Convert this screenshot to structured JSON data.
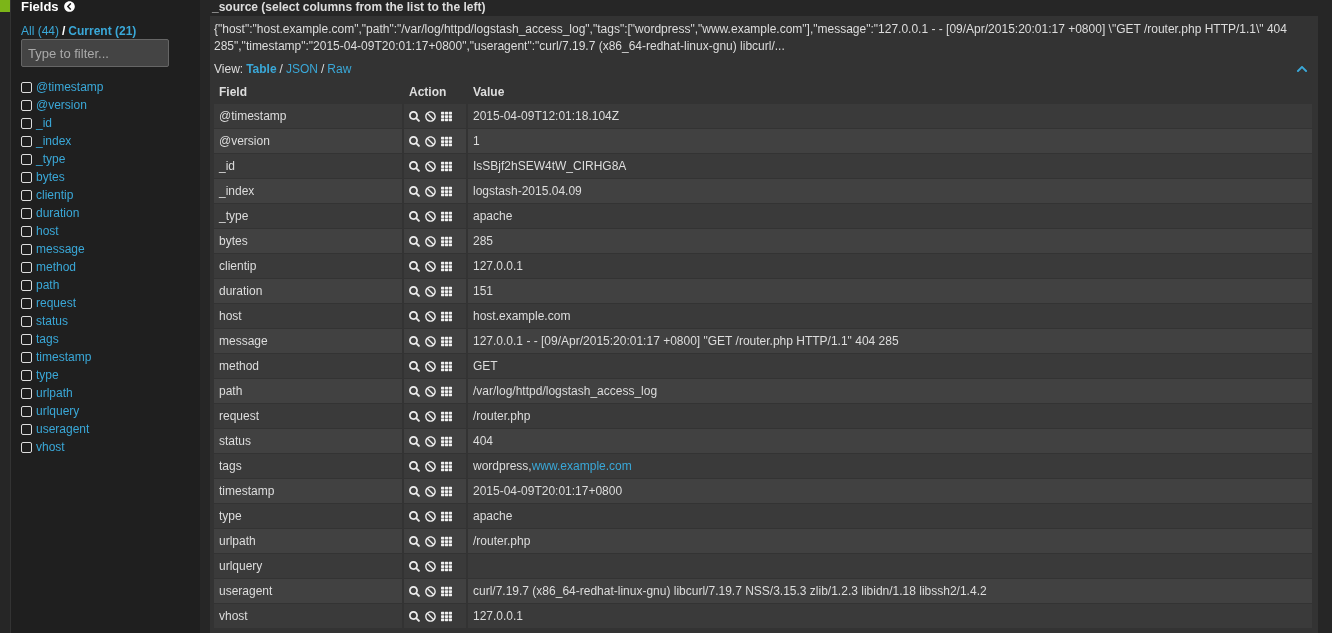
{
  "sidebar": {
    "title": "Fields",
    "filters": [
      {
        "label": "All (44)",
        "selected": false
      },
      {
        "label": "Current (21)",
        "selected": true
      }
    ],
    "separator": "/",
    "filter": {
      "placeholder": "Type to filter..."
    },
    "fields": [
      {
        "name": "@timestamp",
        "checked": false
      },
      {
        "name": "@version",
        "checked": false
      },
      {
        "name": "_id",
        "checked": false
      },
      {
        "name": "_index",
        "checked": false
      },
      {
        "name": "_type",
        "checked": false
      },
      {
        "name": "bytes",
        "checked": false
      },
      {
        "name": "clientip",
        "checked": false
      },
      {
        "name": "duration",
        "checked": false
      },
      {
        "name": "host",
        "checked": false
      },
      {
        "name": "message",
        "checked": false
      },
      {
        "name": "method",
        "checked": false
      },
      {
        "name": "path",
        "checked": false
      },
      {
        "name": "request",
        "checked": false
      },
      {
        "name": "status",
        "checked": false
      },
      {
        "name": "tags",
        "checked": false
      },
      {
        "name": "timestamp",
        "checked": false
      },
      {
        "name": "type",
        "checked": false
      },
      {
        "name": "urlpath",
        "checked": false
      },
      {
        "name": "urlquery",
        "checked": false
      },
      {
        "name": "useragent",
        "checked": false
      },
      {
        "name": "vhost",
        "checked": false
      }
    ]
  },
  "main": {
    "heading": "_source (select columns from the list to the left)",
    "source_text": "{\"host\":\"host.example.com\",\"path\":\"/var/log/httpd/logstash_access_log\",\"tags\":[\"wordpress\",\"www.example.com\"],\"message\":\"127.0.0.1 - - [09/Apr/2015:20:01:17 +0800] \\\"GET /router.php HTTP/1.1\\\" 404 285\",\"timestamp\":\"2015-04-09T20:01:17+0800\",\"useragent\":\"curl/7.19.7 (x86_64-redhat-linux-gnu) libcurl/...",
    "view_label": "View:",
    "view_separator": "/",
    "views": [
      {
        "label": "Table",
        "selected": true
      },
      {
        "label": "JSON",
        "selected": false
      },
      {
        "label": "Raw",
        "selected": false
      }
    ],
    "table": {
      "columns": [
        "Field",
        "Action",
        "Value"
      ],
      "rows": [
        {
          "field": "@timestamp",
          "value": "2015-04-09T12:01:18.104Z"
        },
        {
          "field": "@version",
          "value": "1"
        },
        {
          "field": "_id",
          "value": "IsSBjf2hSEW4tW_CIRHG8A"
        },
        {
          "field": "_index",
          "value": "logstash-2015.04.09"
        },
        {
          "field": "_type",
          "value": "apache"
        },
        {
          "field": "bytes",
          "value": "285"
        },
        {
          "field": "clientip",
          "value": "127.0.0.1"
        },
        {
          "field": "duration",
          "value": "151"
        },
        {
          "field": "host",
          "value": "host.example.com"
        },
        {
          "field": "message",
          "value": "127.0.0.1 - - [09/Apr/2015:20:01:17 +0800] \"GET /router.php HTTP/1.1\" 404 285"
        },
        {
          "field": "method",
          "value": "GET"
        },
        {
          "field": "path",
          "value": "/var/log/httpd/logstash_access_log"
        },
        {
          "field": "request",
          "value": "/router.php"
        },
        {
          "field": "status",
          "value": "404"
        },
        {
          "field": "tags",
          "value": "wordpress,",
          "link": "www.example.com"
        },
        {
          "field": "timestamp",
          "value": "2015-04-09T20:01:17+0800"
        },
        {
          "field": "type",
          "value": "apache"
        },
        {
          "field": "urlpath",
          "value": "/router.php"
        },
        {
          "field": "urlquery"
        },
        {
          "field": "useragent",
          "value": "curl/7.19.7 (x86_64-redhat-linux-gnu) libcurl/7.19.7 NSS/3.15.3 zlib/1.2.3 libidn/1.18 libssh2/1.4.2"
        },
        {
          "field": "vhost",
          "value": "127.0.0.1"
        }
      ]
    }
  }
}
